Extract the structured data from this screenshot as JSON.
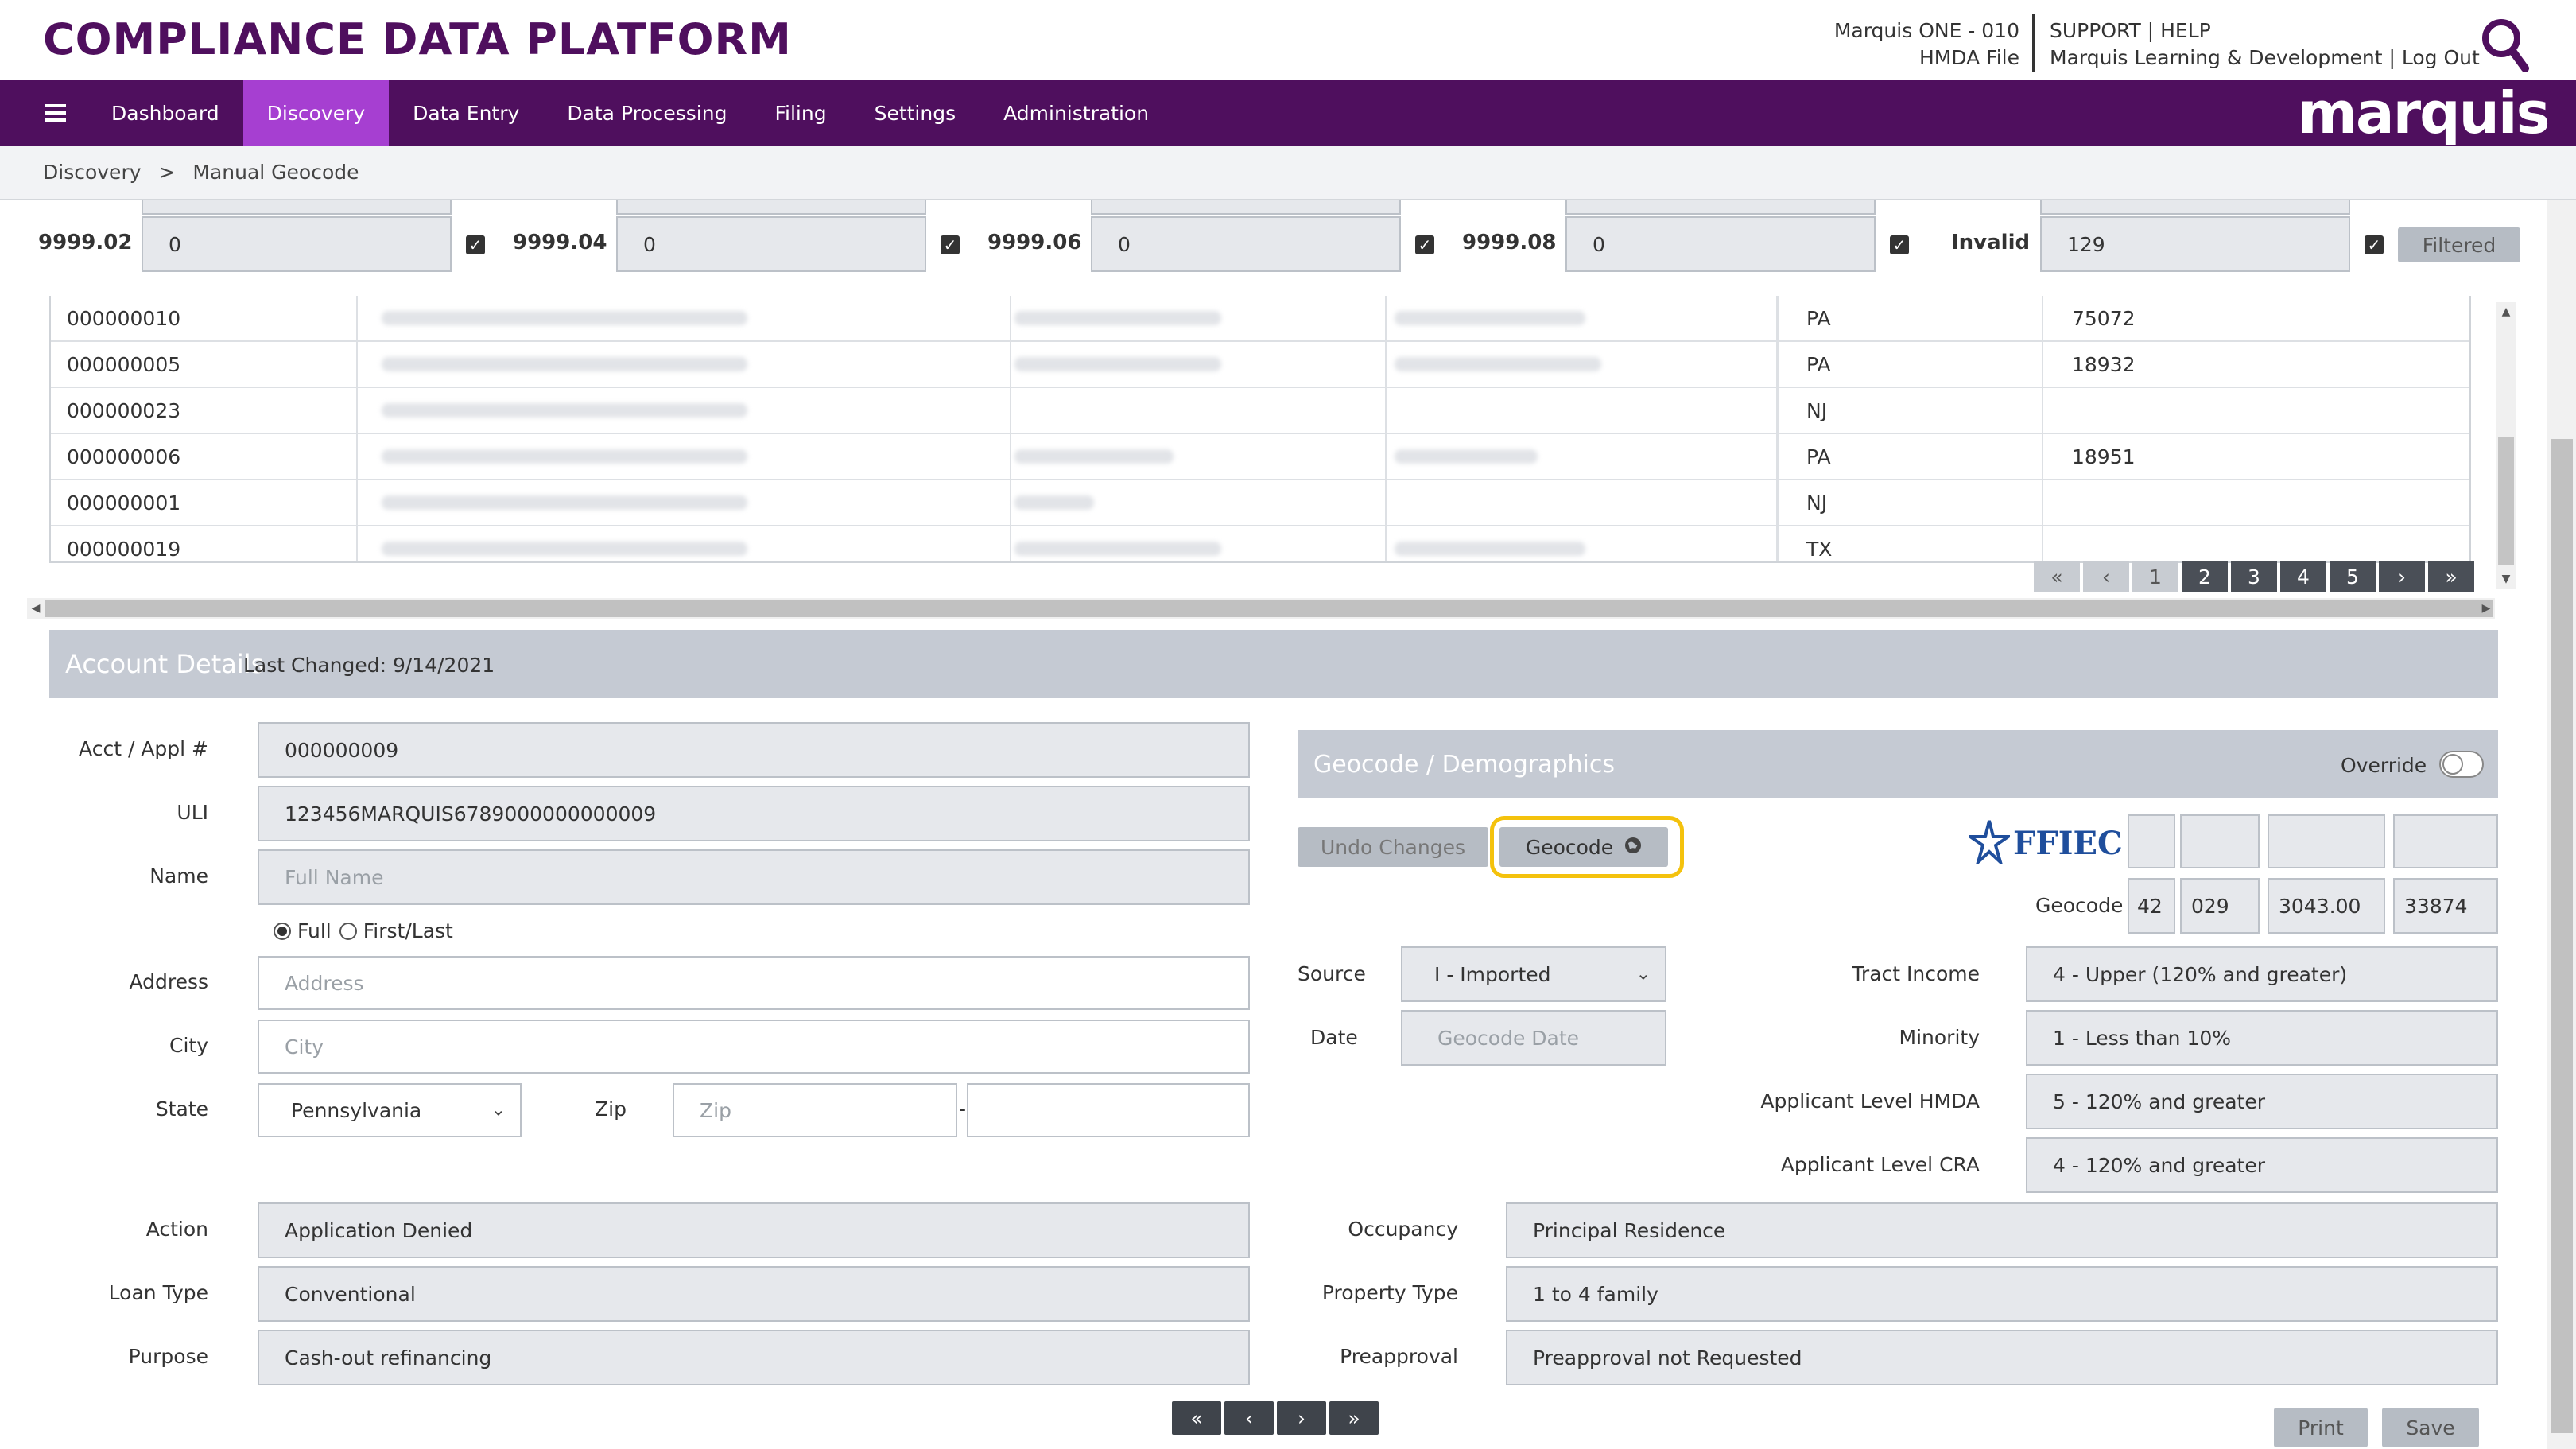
{
  "app": {
    "title": "COMPLIANCE DATA PLATFORM"
  },
  "header_info": {
    "line1": "Marquis ONE - 010",
    "line2": "HMDA File",
    "support": "SUPPORT | HELP",
    "user": "Marquis Learning & Development | Log Out"
  },
  "nav": {
    "items": [
      "Dashboard",
      "Discovery",
      "Data Entry",
      "Data Processing",
      "Filing",
      "Settings",
      "Administration"
    ],
    "active": "Discovery",
    "brand": "marquis"
  },
  "breadcrumb": {
    "parent": "Discovery",
    "sep": ">",
    "current": "Manual Geocode"
  },
  "filters": [
    {
      "label": "9999.02",
      "value": "0"
    },
    {
      "label": "9999.04",
      "value": "0"
    },
    {
      "label": "9999.06",
      "value": "0"
    },
    {
      "label": "9999.08",
      "value": "0"
    },
    {
      "label": "Invalid",
      "value": "129"
    }
  ],
  "filtered_button": "Filtered",
  "table": {
    "rows": [
      {
        "id": "000000010",
        "state": "PA",
        "zip": "75072"
      },
      {
        "id": "000000005",
        "state": "PA",
        "zip": "18932"
      },
      {
        "id": "000000023",
        "state": "NJ",
        "zip": ""
      },
      {
        "id": "000000006",
        "state": "PA",
        "zip": "18951"
      },
      {
        "id": "000000001",
        "state": "NJ",
        "zip": ""
      },
      {
        "id": "000000019",
        "state": "TX",
        "zip": ""
      }
    ],
    "pager": {
      "first": "«",
      "prev": "‹",
      "pages": [
        "1",
        "2",
        "3",
        "4",
        "5"
      ],
      "next": "›",
      "last": "»"
    }
  },
  "account": {
    "title": "Account Details",
    "last_changed": "Last Changed: 9/14/2021",
    "acct_label": "Acct / Appl #",
    "acct_value": "000000009",
    "uli_label": "ULI",
    "uli_value": "123456MARQUIS6789000000000009",
    "name_label": "Name",
    "name_placeholder": "Full Name",
    "radio_full": "Full",
    "radio_firstlast": "First/Last",
    "address_label": "Address",
    "address_placeholder": "Address",
    "city_label": "City",
    "city_placeholder": "City",
    "state_label": "State",
    "state_value": "Pennsylvania",
    "zip_label": "Zip",
    "zip_placeholder": "Zip",
    "zip_sep": "-",
    "action_label": "Action",
    "action_value": "Application Denied",
    "loantype_label": "Loan Type",
    "loantype_value": "Conventional",
    "purpose_label": "Purpose",
    "purpose_value": "Cash-out refinancing"
  },
  "geo": {
    "title": "Geocode / Demographics",
    "override_label": "Override",
    "override_on": false,
    "undo_label": "Undo Changes",
    "geocode_btn": "Geocode",
    "ffiec": "FFIEC",
    "geocode_label": "Geocode",
    "codes": [
      "42",
      "029",
      "3043.00",
      "33874"
    ],
    "source_label": "Source",
    "source_value": "I - Imported",
    "date_label": "Date",
    "date_placeholder": "Geocode Date",
    "tract_label": "Tract Income",
    "tract_value": "4 - Upper (120% and greater)",
    "minority_label": "Minority",
    "minority_value": "1 - Less than 10%",
    "hmda_label": "Applicant Level HMDA",
    "hmda_value": "5 - 120% and greater",
    "cra_label": "Applicant Level CRA",
    "cra_value": "4 - 120% and greater",
    "occupancy_label": "Occupancy",
    "occupancy_value": "Principal Residence",
    "ptype_label": "Property Type",
    "ptype_value": "1 to 4 family",
    "preapproval_label": "Preapproval",
    "preapproval_value": "Preapproval not Requested"
  },
  "bottom_pager": [
    "«",
    "‹",
    "›",
    "»"
  ],
  "actions": {
    "print": "Print",
    "save": "Save"
  },
  "colors": {
    "brand_purple": "#4f0f5e",
    "active_tab": "#a63fd1",
    "highlight": "#f4c20d"
  }
}
